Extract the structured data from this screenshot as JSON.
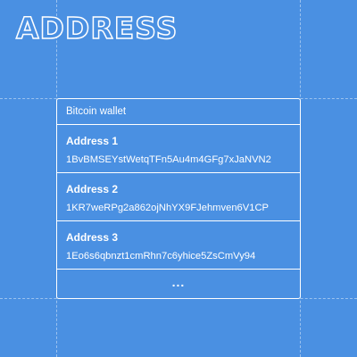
{
  "page": {
    "title": "ADDRESS"
  },
  "wallet": {
    "title": "Bitcoin wallet",
    "addresses": [
      {
        "label": "Address 1",
        "value": "1BvBMSEYstWetqTFn5Au4m4GFg7xJaNVN2"
      },
      {
        "label": "Address 2",
        "value": "1KR7weRPg2a862ojNhYX9FJehmven6V1CP"
      },
      {
        "label": "Address 3",
        "value": "1Eo6s6qbnzt1cmRhn7c6yhice5ZsCmVy94"
      }
    ],
    "more_label": "..."
  },
  "colors": {
    "background": "#4a90e2",
    "foreground": "#ffffff"
  }
}
